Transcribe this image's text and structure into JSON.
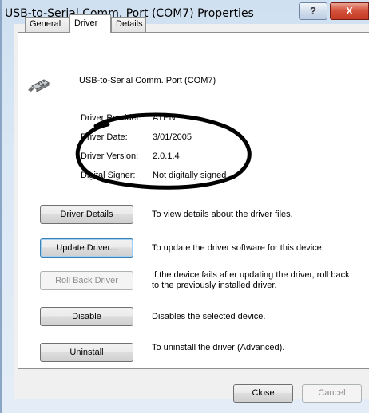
{
  "window": {
    "title": "USB-to-Serial Comm. Port (COM7) Properties",
    "help_glyph": "?",
    "close_glyph": "X"
  },
  "tabs": [
    {
      "label": "General",
      "active": false
    },
    {
      "label": "Driver",
      "active": true
    },
    {
      "label": "Details",
      "active": false
    }
  ],
  "device": {
    "name": "USB-to-Serial Comm. Port (COM7)",
    "icon": "serial-port-connector-icon"
  },
  "info": {
    "provider_label": "Driver Provider:",
    "provider_value": "ATEN",
    "date_label": "Driver Date:",
    "date_value": "3/01/2005",
    "version_label": "Driver Version:",
    "version_value": "2.0.1.4",
    "signer_label": "Digital Signer:",
    "signer_value": "Not digitally signed"
  },
  "actions": [
    {
      "button": "Driver Details",
      "description": "To view details about the driver files."
    },
    {
      "button": "Update Driver...",
      "description": "To update the driver software for this device."
    },
    {
      "button": "Roll Back Driver",
      "description": "If the device fails after updating the driver, roll back to the previously installed driver."
    },
    {
      "button": "Disable",
      "description": "Disables the selected device."
    },
    {
      "button": "Uninstall",
      "description": "To uninstall the driver (Advanced)."
    }
  ],
  "footer": {
    "close_label": "Close",
    "cancel_label": "Cancel"
  },
  "annotation": {
    "stroke_color": "#000000"
  }
}
